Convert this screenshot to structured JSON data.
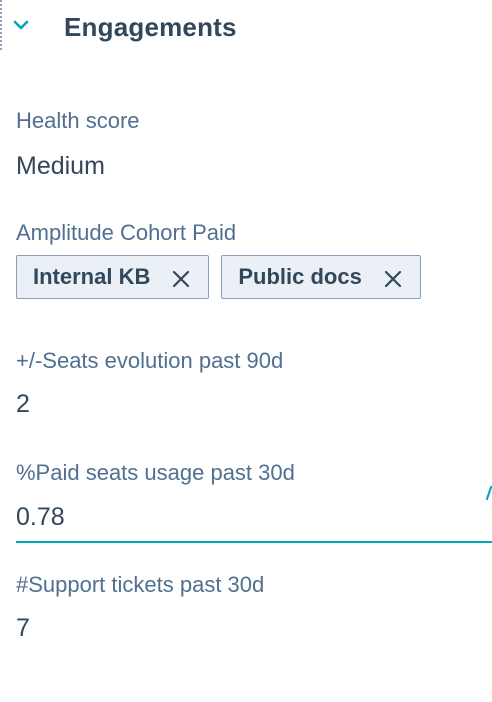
{
  "section": {
    "title": "Engagements",
    "expand_icon": "chevron-down-icon"
  },
  "fields": {
    "health_score": {
      "label": "Health score",
      "value": "Medium"
    },
    "amplitude_cohort": {
      "label": "Amplitude Cohort Paid",
      "tags": [
        {
          "label": "Internal KB",
          "remove_icon": "close-icon"
        },
        {
          "label": "Public docs",
          "remove_icon": "close-icon"
        }
      ]
    },
    "seats_evolution": {
      "label": "+/-Seats evolution past 90d",
      "value": "2"
    },
    "paid_seats_usage": {
      "label": "%Paid seats usage past 30d",
      "value": "0.78"
    },
    "support_tickets": {
      "label": "#Support tickets past 30d",
      "value": "7"
    }
  },
  "colors": {
    "accent": "#00a4bd",
    "text": "#33475b",
    "label": "#516f90",
    "tag_background": "#eaf0f6",
    "tag_border": "#8aa1b6"
  }
}
